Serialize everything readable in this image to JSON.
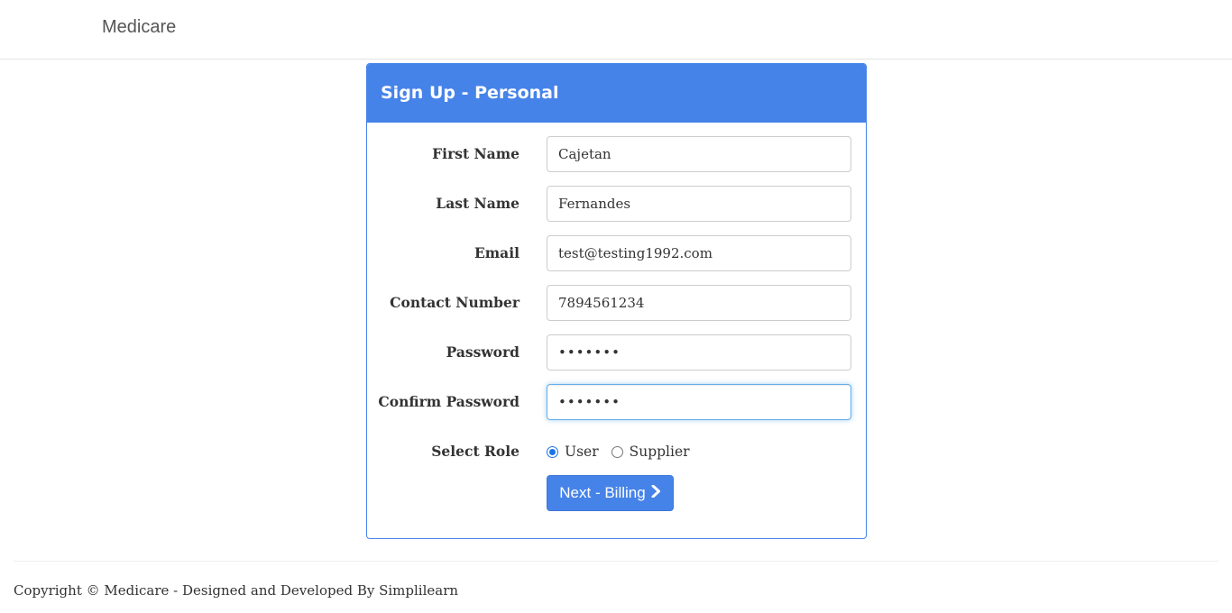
{
  "navbar": {
    "brand": "Medicare"
  },
  "panel": {
    "title": "Sign Up - Personal"
  },
  "form": {
    "fields": [
      {
        "label": "First Name",
        "value": "Cajetan",
        "type": "text"
      },
      {
        "label": "Last Name",
        "value": "Fernandes",
        "type": "text"
      },
      {
        "label": "Email",
        "value": "test@testing1992.com",
        "type": "email"
      },
      {
        "label": "Contact Number",
        "value": "7894561234",
        "type": "text"
      },
      {
        "label": "Password",
        "value": "•••••••",
        "type": "password"
      },
      {
        "label": "Confirm Password",
        "value": "•••••••",
        "type": "password",
        "focused": true
      }
    ],
    "role": {
      "label": "Select Role",
      "options": [
        {
          "label": "User",
          "checked": true
        },
        {
          "label": "Supplier",
          "checked": false
        }
      ]
    },
    "next_button": {
      "label": "Next - Billing",
      "icon": "chevron-right-icon"
    }
  },
  "footer": {
    "text": "Copyright © Medicare - Designed and Developed By Simplilearn"
  },
  "colors": {
    "primary": "#4683e9",
    "focus_border": "#66afe9",
    "radio_checked": "#1a73e8"
  }
}
